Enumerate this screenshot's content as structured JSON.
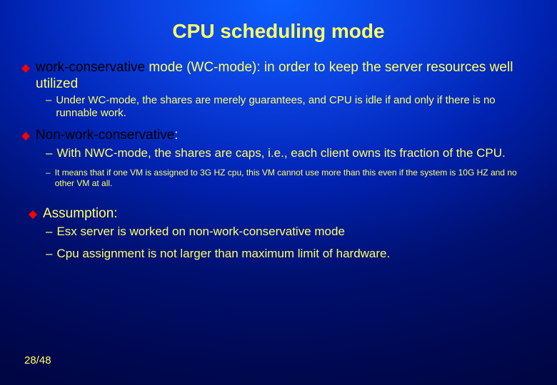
{
  "title": "CPU scheduling mode",
  "b1": {
    "lead": "work-conservative",
    "tail": " mode (WC-mode): in order to keep the server resources well utilized",
    "sub": "Under WC-mode, the shares are merely guarantees, and CPU is idle if and only if there is no runnable work."
  },
  "b2": {
    "lead": "Non-work-conservative",
    "tail": ":",
    "sub1": "With NWC-mode, the shares are caps, i.e., each client owns its fraction of the CPU.",
    "sub2": "It means that if one VM is assigned to 3G HZ cpu, this VM cannot use more than this even if the system is 10G HZ and no other VM at all."
  },
  "b3": {
    "lead": "Assumption:",
    "sub1": "Esx server is worked on non-work-conservative mode",
    "sub2": "Cpu assignment is not larger than maximum limit of hardware."
  },
  "page": "28/48"
}
